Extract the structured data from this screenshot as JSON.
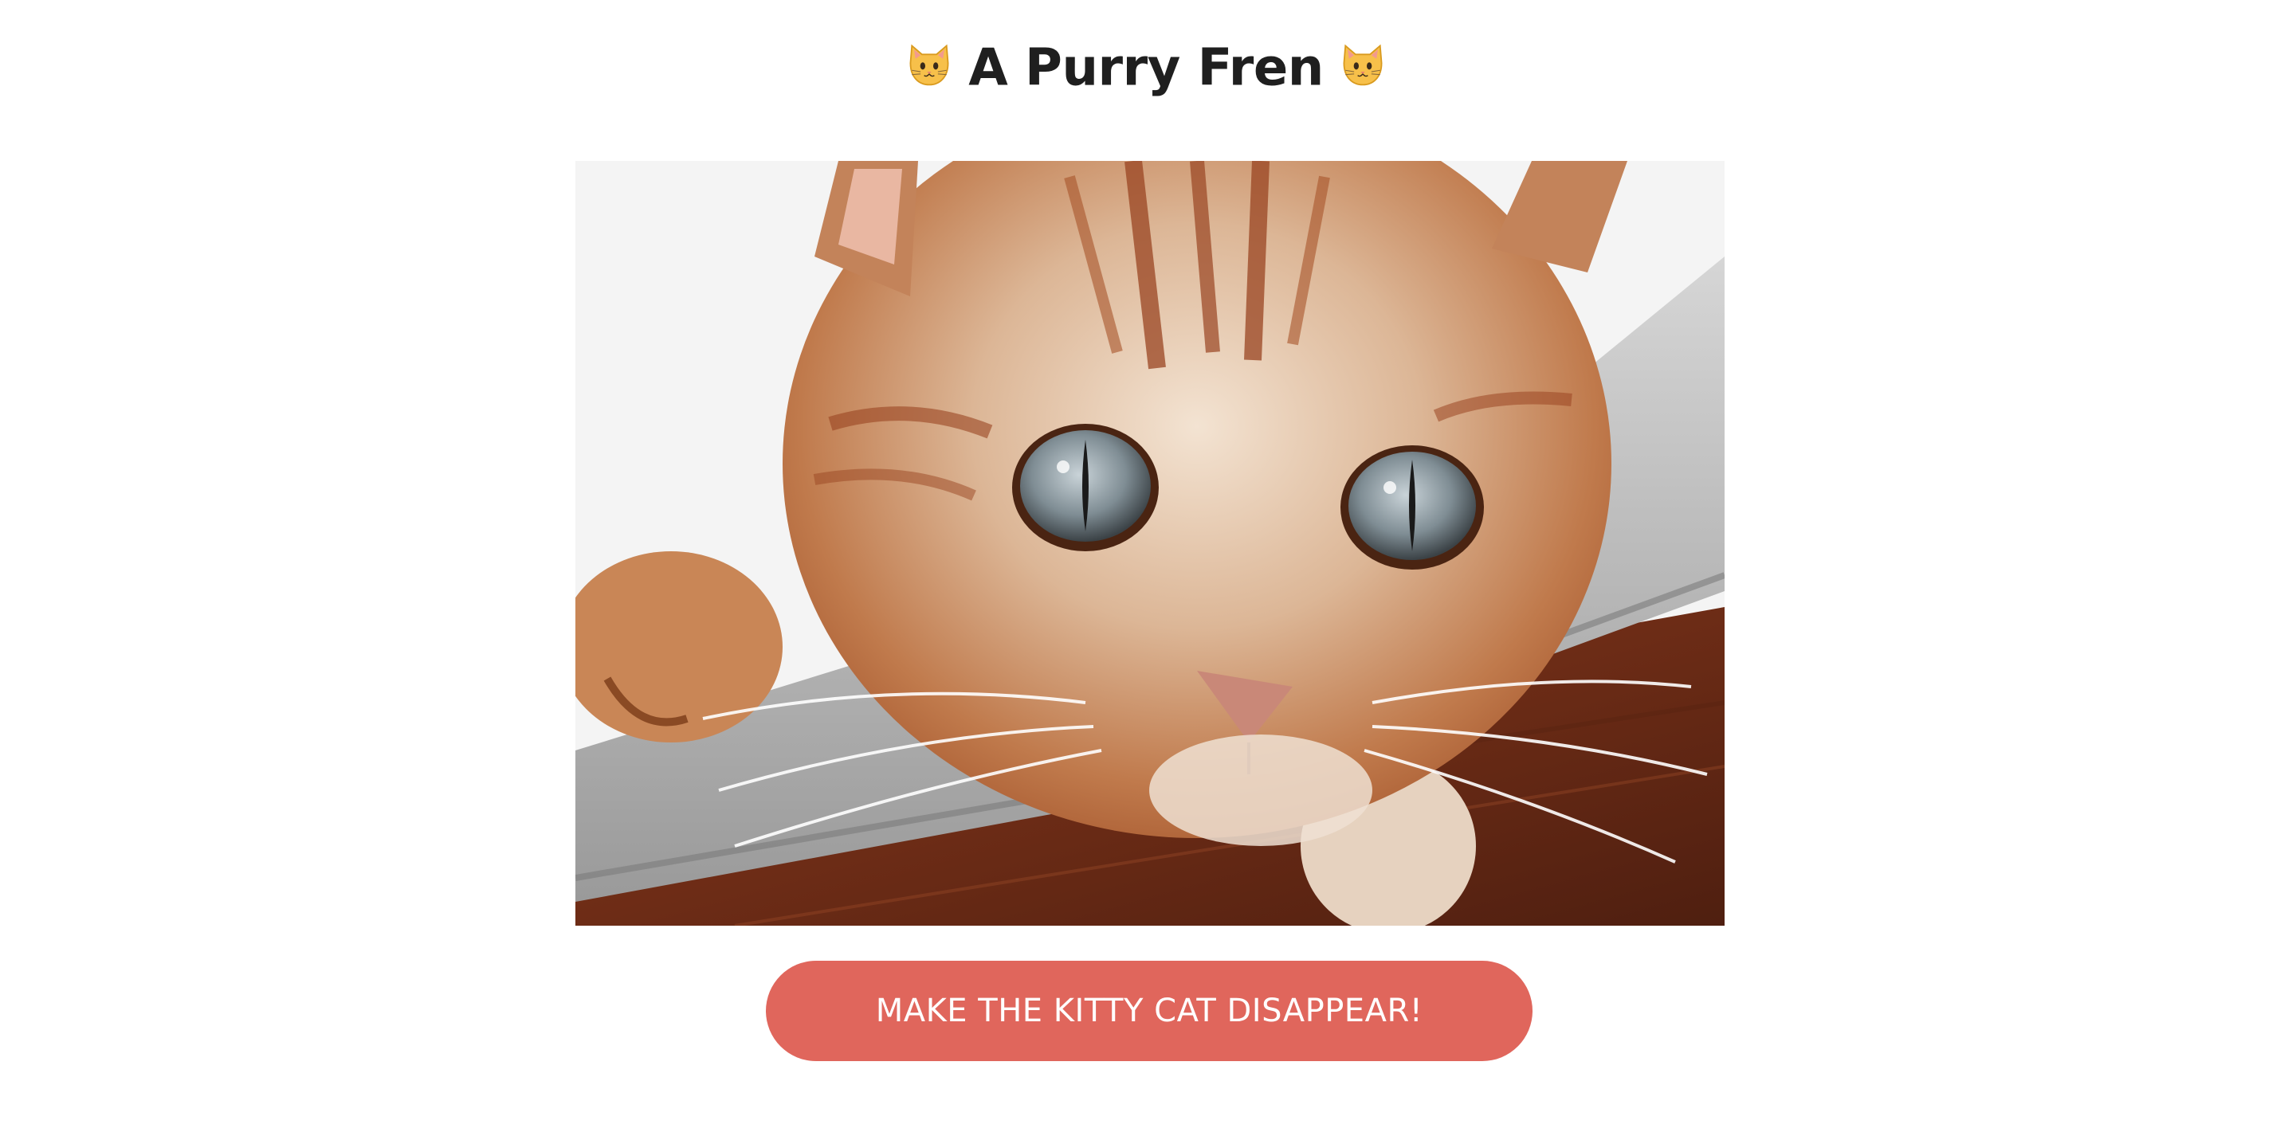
{
  "header": {
    "title": "A Purry Fren",
    "left_icon": "cat-face-icon",
    "right_icon": "cat-face-icon"
  },
  "photo": {
    "subject": "orange tabby cat close-up"
  },
  "cta": {
    "label": "MAKE THE KITTY CAT DISAPPEAR!",
    "color": "#e0665c"
  }
}
